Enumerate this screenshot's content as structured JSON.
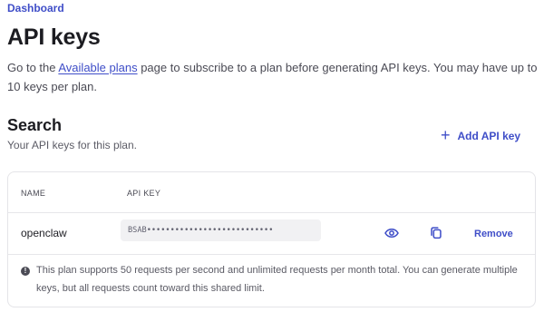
{
  "breadcrumb": {
    "label": "Dashboard"
  },
  "page": {
    "title": "API keys",
    "intro_before_link": "Go to the ",
    "intro_link": "Available plans",
    "intro_after_link": " page to subscribe to a plan before generating API keys. You may have up to 10 keys per plan."
  },
  "section": {
    "title": "Search",
    "subtitle": "Your API keys for this plan.",
    "add_button_icon": "plus-icon",
    "add_button_symbol": "+",
    "add_button_label": "Add API key"
  },
  "table": {
    "headers": {
      "name": "NAME",
      "key": "API KEY"
    },
    "rows": [
      {
        "name": "openclaw",
        "key": "BSAB•••••••••••••••••••••••••••",
        "view_icon": "eye-icon",
        "copy_icon": "copy-icon",
        "remove_label": "Remove"
      }
    ],
    "notice": {
      "icon": "info-icon",
      "icon_symbol": "!",
      "text": "This plan supports 50 requests per second and unlimited requests per month total. You can generate multiple keys, but all requests count toward this shared limit."
    }
  },
  "colors": {
    "accent": "#3f4ec8",
    "text": "#1f1f24",
    "muted_text": "#5a5a64",
    "border": "#e4e4e8",
    "key_background": "#f1f1f3"
  }
}
